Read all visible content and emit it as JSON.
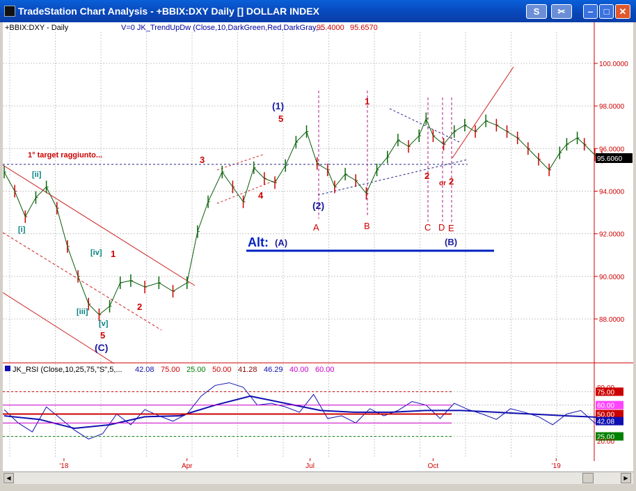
{
  "window": {
    "title": "TradeStation Chart Analysis - +BBIX:DXY Daily [] DOLLAR INDEX",
    "btn_s": "S",
    "btn_copy": "✂"
  },
  "chart_data": [
    {
      "type": "line",
      "title": "+BBIX:DXY - Daily",
      "indicator": "V=0  JK_TrendUpDw (Close,10,DarkGreen,Red,DarkGray,...",
      "indicator_values": [
        "95.4000",
        "95.6570"
      ],
      "ylim": [
        86,
        101
      ],
      "y_ticks": [
        "100.0000",
        "98.0000",
        "96.0000",
        "94.0000",
        "92.0000",
        "90.0000",
        "88.0000"
      ],
      "y_tick_values": [
        100,
        98,
        96,
        94,
        92,
        90,
        88
      ],
      "last_value": "95.6060",
      "x_ticks": [
        "'18",
        "Apr",
        "Jul",
        "Oct",
        "'19",
        "Apr"
      ],
      "x_tick_index": [
        17,
        52,
        87,
        122,
        157,
        192
      ],
      "x_range": [
        0,
        240
      ],
      "series": [
        {
          "style": "ohlc",
          "x": [
            0,
            3,
            6,
            9,
            12,
            15,
            18,
            21,
            24,
            27,
            30,
            33,
            36,
            40,
            44,
            48,
            52,
            55,
            58,
            62,
            65,
            68,
            71,
            74,
            77,
            80,
            83,
            86,
            89,
            92,
            94,
            97,
            100,
            103,
            106,
            109,
            112,
            115,
            118,
            120,
            122,
            125,
            128,
            131,
            134,
            137,
            140,
            143,
            146,
            149,
            152,
            155,
            158,
            160,
            163,
            165,
            168,
            170
          ],
          "y": [
            94.9,
            94,
            92.8,
            93.7,
            94.2,
            93.2,
            91.4,
            90,
            88.7,
            88.2,
            88.6,
            89.7,
            89.8,
            89.5,
            89.7,
            89.3,
            89.7,
            92.1,
            93.5,
            94.9,
            94.2,
            93.5,
            95.1,
            94.6,
            94.4,
            95.2,
            96.3,
            96.8,
            95.3,
            95,
            94.2,
            94.8,
            94.5,
            93.9,
            95,
            95.6,
            96.4,
            96.1,
            96.6,
            97.4,
            96.6,
            96.2,
            96.8,
            97.1,
            96.8,
            97.3,
            97.1,
            96.8,
            96.5,
            96,
            95.5,
            95,
            95.8,
            96.2,
            96.5,
            96.2,
            95.7,
            95.6
          ],
          "color": "#0a5a0a"
        }
      ],
      "wave_labels": [
        "(1)",
        "5",
        "(2)",
        "1",
        "3",
        "4",
        "1° target raggiunto...",
        "[ii]",
        "[i]",
        "[iv]",
        "1",
        "[iii]",
        "[v]",
        "5",
        "(C)",
        "2",
        "2",
        "2",
        "or",
        "A",
        "B",
        "C",
        "D",
        "E",
        "Alt:",
        "(A)",
        "(B)"
      ]
    },
    {
      "type": "line",
      "title": "JK_RSI (Close,10,25,75,\"S\",5,...",
      "legend_values": [
        "42.08",
        "75.00",
        "25.00",
        "50.00",
        "41.28",
        "46.29",
        "40.00",
        "60.00"
      ],
      "legend_colors": [
        "#1010b0",
        "#cc0000",
        "#008000",
        "#cc0000",
        "#880000",
        "#1010b0",
        "#cc00cc",
        "#cc00cc"
      ],
      "ylim": [
        20,
        90
      ],
      "y_ticks": [
        "80.00",
        "75.00",
        "60.00",
        "50.00",
        "42.08",
        "25.00",
        "20.00"
      ],
      "y_tick_values": [
        80,
        75,
        60,
        50,
        42.08,
        25,
        20
      ],
      "levels": [
        75,
        60,
        50,
        40,
        25
      ],
      "series": [
        {
          "name": "RSI",
          "x": [
            0,
            4,
            8,
            12,
            16,
            20,
            24,
            28,
            32,
            36,
            40,
            44,
            48,
            52,
            56,
            60,
            64,
            68,
            72,
            76,
            80,
            84,
            88,
            92,
            96,
            100,
            104,
            108,
            112,
            116,
            120,
            124,
            128,
            132,
            136,
            140,
            144,
            148,
            152,
            156,
            160,
            164,
            168,
            170
          ],
          "y": [
            55,
            40,
            30,
            58,
            45,
            32,
            22,
            28,
            50,
            38,
            55,
            48,
            42,
            50,
            70,
            82,
            85,
            80,
            60,
            62,
            58,
            52,
            72,
            45,
            48,
            40,
            56,
            48,
            54,
            64,
            60,
            45,
            62,
            55,
            50,
            44,
            56,
            52,
            47,
            38,
            50,
            54,
            40,
            42.08
          ],
          "color": "#1010b0"
        },
        {
          "name": "Average",
          "x": [
            0,
            10,
            20,
            30,
            40,
            50,
            60,
            70,
            80,
            90,
            100,
            110,
            120,
            130,
            140,
            150,
            160,
            170
          ],
          "y": [
            48,
            44,
            34,
            38,
            47,
            48,
            60,
            70,
            62,
            54,
            52,
            52,
            54,
            54,
            52,
            50,
            48,
            46.3
          ],
          "color": "#1010b0"
        }
      ]
    }
  ]
}
